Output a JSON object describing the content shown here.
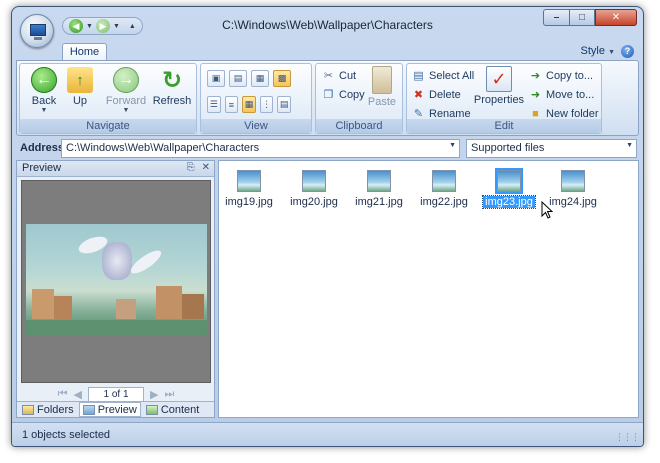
{
  "window": {
    "title": "C:\\Windows\\Web\\Wallpaper\\Characters"
  },
  "ribbon": {
    "tab_home": "Home",
    "style_label": "Style",
    "help": "?",
    "navigate": {
      "label": "Navigate",
      "back": "Back",
      "up": "Up",
      "forward": "Forward",
      "refresh": "Refresh"
    },
    "view": {
      "label": "View"
    },
    "clipboard": {
      "label": "Clipboard",
      "cut": "Cut",
      "copy": "Copy",
      "paste": "Paste"
    },
    "edit": {
      "label": "Edit",
      "select_all": "Select All",
      "delete": "Delete",
      "rename": "Rename",
      "properties": "Properties",
      "copy_to": "Copy to...",
      "move_to": "Move to...",
      "new_folder": "New folder"
    }
  },
  "address": {
    "label": "Address",
    "path": "C:\\Windows\\Web\\Wallpaper\\Characters",
    "filter": "Supported files"
  },
  "preview": {
    "title": "Preview",
    "pin": "⎘",
    "close": "✕",
    "page": "1 of 1",
    "tabs": [
      "Folders",
      "Preview",
      "Content"
    ]
  },
  "files": [
    {
      "name": "img19.jpg",
      "selected": false
    },
    {
      "name": "img20.jpg",
      "selected": false
    },
    {
      "name": "img21.jpg",
      "selected": false
    },
    {
      "name": "img22.jpg",
      "selected": false
    },
    {
      "name": "img23.jpg",
      "selected": true
    },
    {
      "name": "img24.jpg",
      "selected": false
    }
  ],
  "status": {
    "text": "1 objects selected"
  }
}
